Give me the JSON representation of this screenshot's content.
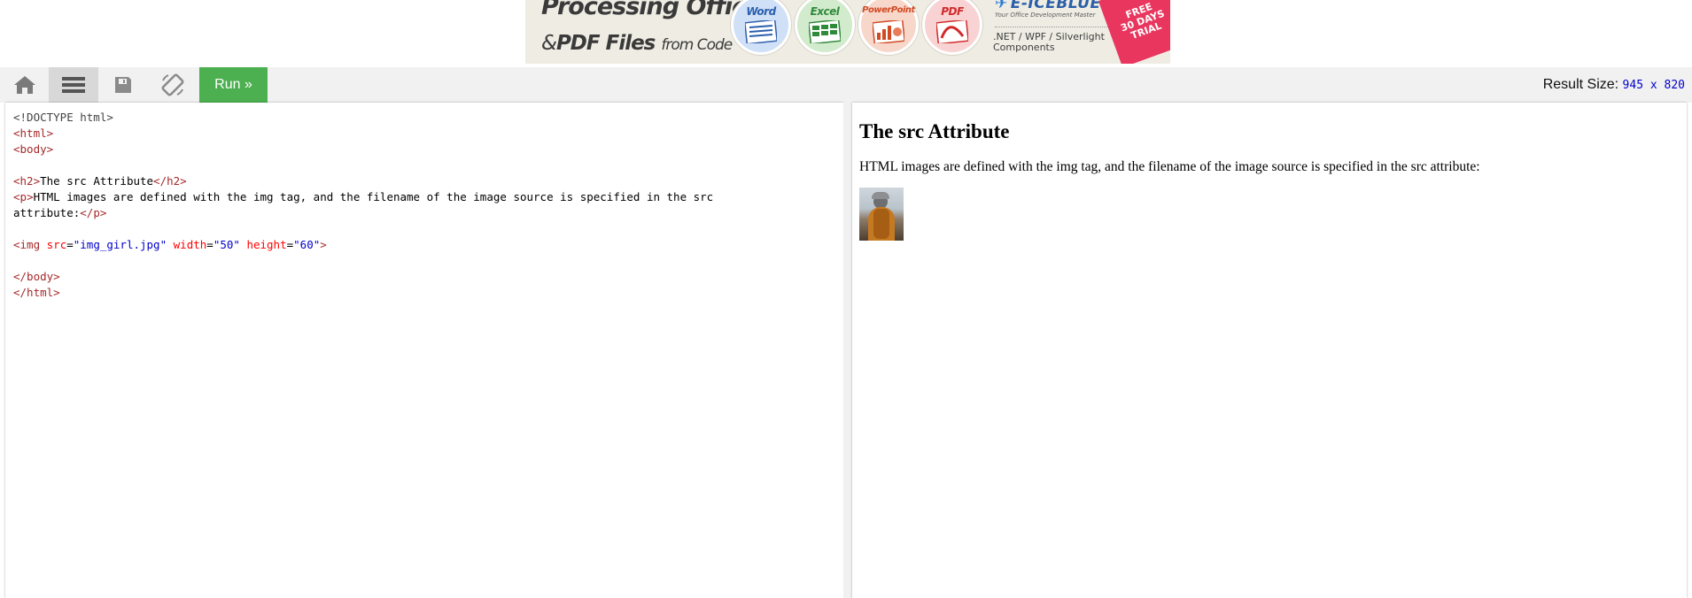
{
  "ad": {
    "headline_line1": "Processing Office",
    "headline_amp": "&",
    "headline_line2": "PDF Files",
    "headline_line2_suffix": "from Code",
    "formats": [
      "Word",
      "Excel",
      "PowerPoint",
      "PDF"
    ],
    "brand": "E-ICEBLUE",
    "tagline": "Your Office Development Master",
    "platforms_line1": ".NET / WPF / Silverlight",
    "platforms_line2": "Components",
    "trial_line1": "FREE",
    "trial_line2": "30 DAYS",
    "trial_line3": "TRIAL"
  },
  "toolbar": {
    "icons": [
      "home-icon",
      "menu-icon",
      "save-icon",
      "rotate-icon"
    ],
    "run_label": "Run »",
    "result_size_label": "Result Size:",
    "result_size_value": "945 x 820"
  },
  "editor": {
    "lines": [
      "<!DOCTYPE html>",
      "<html>",
      "<body>",
      "",
      "<h2>The src Attribute</h2>",
      "<p>HTML images are defined with the img tag, and the filename of the image source is specified in the src",
      "attribute:</p>",
      "",
      "<img src=\"img_girl.jpg\" width=\"50\" height=\"60\">",
      "",
      "</body>",
      "</html>"
    ]
  },
  "preview": {
    "heading": "The src Attribute",
    "paragraph": "HTML images are defined with the img tag, and the filename of the image source is specified in the src attribute:"
  },
  "colors": {
    "run_button": "#4caf50",
    "toolbar_bg": "#f1f1f1",
    "code_tag": "#a52a2a",
    "code_attr": "#ff0000",
    "code_value": "#0000cd"
  }
}
